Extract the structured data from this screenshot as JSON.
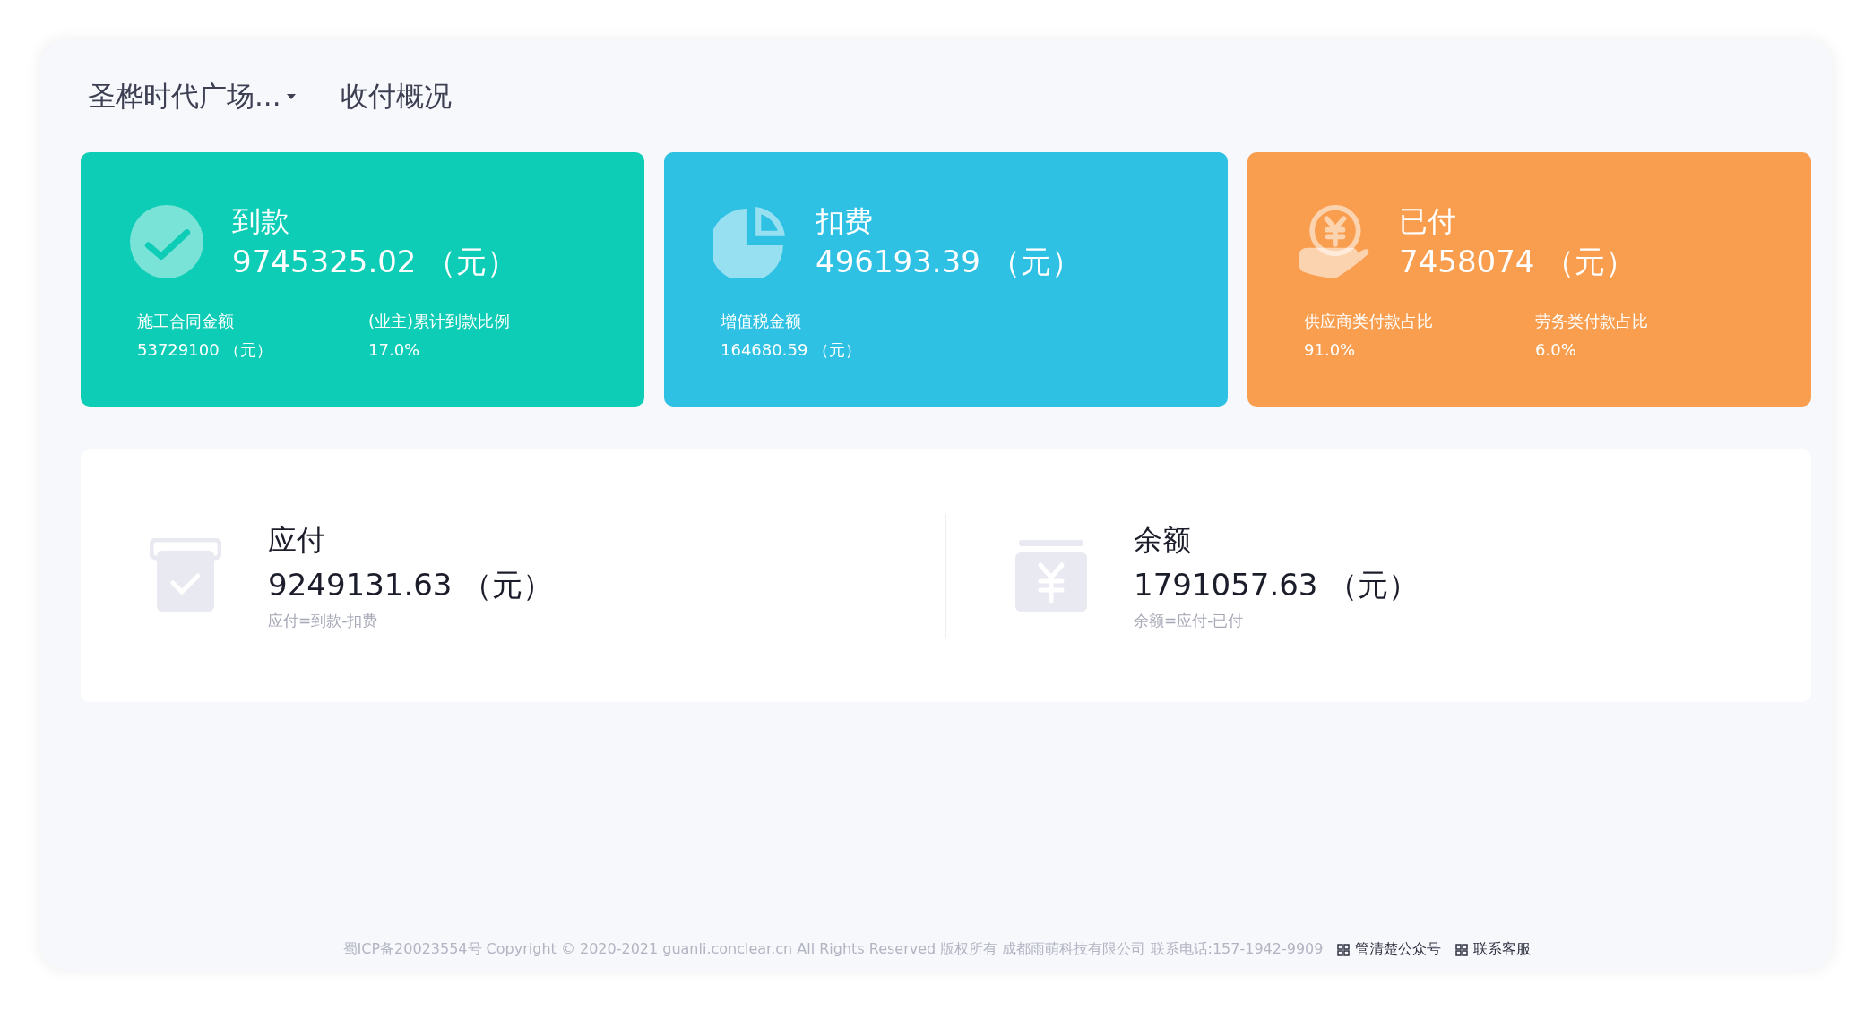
{
  "header": {
    "project_selector": "圣桦时代广场...",
    "page_title": "收付概况"
  },
  "summary_cards": [
    {
      "kind": "received",
      "title": "到款",
      "amount": "9745325.02 （元）",
      "details": [
        {
          "label": "施工合同金额",
          "value": "53729100 （元）"
        },
        {
          "label": "(业主)累计到款比例",
          "value": "17.0%"
        }
      ]
    },
    {
      "kind": "deducted",
      "title": "扣费",
      "amount": "496193.39 （元）",
      "details": [
        {
          "label": "增值税金额",
          "value": "164680.59 （元）"
        }
      ]
    },
    {
      "kind": "paid",
      "title": "已付",
      "amount": "7458074 （元）",
      "details": [
        {
          "label": "供应商类付款占比",
          "value": "91.0%"
        },
        {
          "label": "劳务类付款占比",
          "value": "6.0%"
        }
      ]
    }
  ],
  "balances": [
    {
      "kind": "payable",
      "title": "应付",
      "amount": "9249131.63 （元）",
      "formula": "应付=到款-扣费"
    },
    {
      "kind": "balance",
      "title": "余额",
      "amount": "1791057.63 （元）",
      "formula": "余额=应付-已付"
    }
  ],
  "footer": {
    "text": "蜀ICP备20023554号 Copyright © 2020-2021 guanli.conclear.cn All Rights Reserved 版权所有 成都雨萌科技有限公司 联系电话:157-1942-9909",
    "links": [
      "管清楚公众号",
      "联系客服"
    ]
  }
}
